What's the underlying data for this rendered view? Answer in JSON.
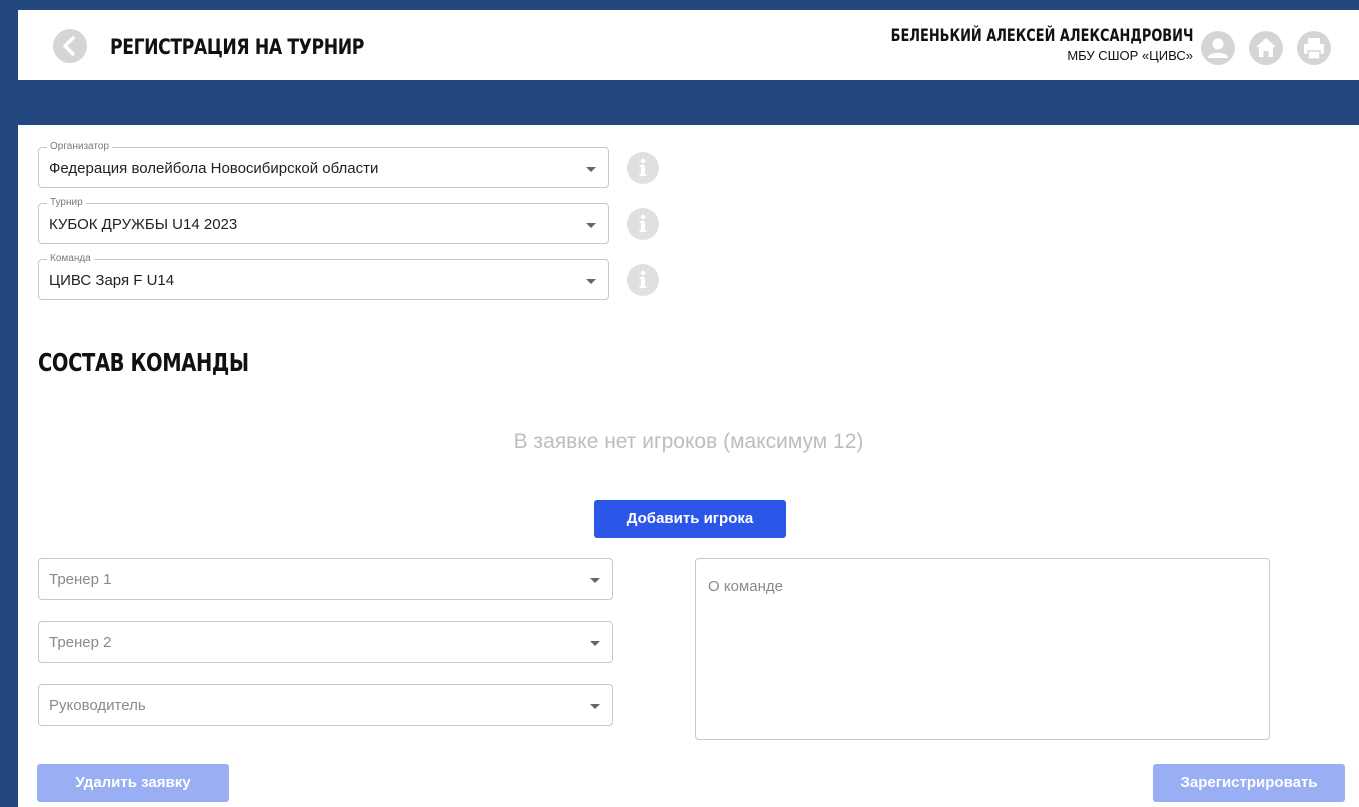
{
  "header": {
    "title": "РЕГИСТРАЦИЯ НА ТУРНИР",
    "user_name": "БЕЛЕНЬКИЙ АЛЕКСЕЙ АЛЕКСАНДРОВИЧ",
    "user_org": "МБУ СШОР «ЦИВС»",
    "icons": [
      "back-icon",
      "user-icon",
      "home-icon",
      "print-icon"
    ]
  },
  "filters": {
    "organizer": {
      "legend": "Организатор",
      "value": "Федерация волейбола Новосибирской области"
    },
    "tournament": {
      "legend": "Турнир",
      "value": "КУБОК ДРУЖБЫ U14 2023"
    },
    "team": {
      "legend": "Команда",
      "value": "ЦИВС Заря F U14"
    }
  },
  "roster": {
    "title": "СОСТАВ КОМАНДЫ",
    "empty_message": "В заявке нет игроков (максимум 12)",
    "add_player_label": "Добавить игрока"
  },
  "staff": {
    "coach1_placeholder": "Тренер 1",
    "coach2_placeholder": "Тренер 2",
    "manager_placeholder": "Руководитель"
  },
  "about": {
    "placeholder": "О команде"
  },
  "actions": {
    "delete_label": "Удалить заявку",
    "register_label": "Зарегистрировать"
  },
  "colors": {
    "frame": "#234880",
    "primary_button": "#2b56e8",
    "disabled_button": "#9aaef4",
    "icon_bg": "#d5d5d5"
  }
}
